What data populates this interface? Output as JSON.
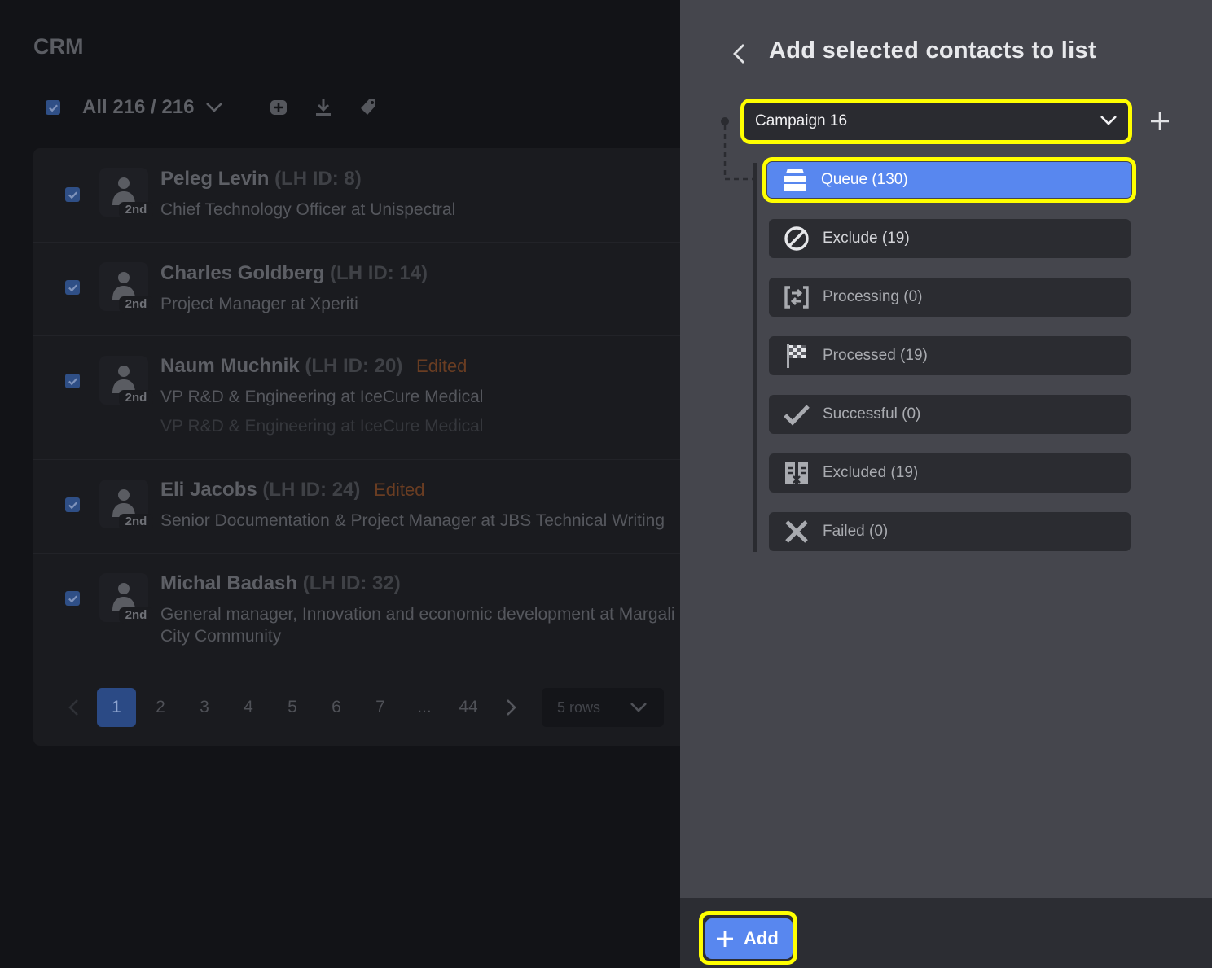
{
  "crm": {
    "title": "CRM",
    "selection_count": "All 216 / 216",
    "contacts": [
      {
        "name": "Peleg Levin",
        "lhid": "(LH ID: 8)",
        "edited": "",
        "degree": "2nd",
        "job": "Chief Technology Officer at Unispectral",
        "job2": ""
      },
      {
        "name": "Charles Goldberg",
        "lhid": "(LH ID: 14)",
        "edited": "",
        "degree": "2nd",
        "job": "Project Manager at Xperiti",
        "job2": ""
      },
      {
        "name": "Naum Muchnik",
        "lhid": "(LH ID: 20)",
        "edited": "Edited",
        "degree": "2nd",
        "job": "VP R&D & Engineering at IceCure Medical",
        "job2": "VP R&D & Engineering at IceCure Medical"
      },
      {
        "name": "Eli Jacobs",
        "lhid": "(LH ID: 24)",
        "edited": "Edited",
        "degree": "2nd",
        "job": "Senior Documentation & Project Manager at JBS Technical Writing",
        "job2": ""
      },
      {
        "name": "Michal Badash",
        "lhid": "(LH ID: 32)",
        "edited": "",
        "degree": "2nd",
        "job": "General manager, Innovation and economic development at Margali",
        "job2": "City Community"
      }
    ],
    "pagination": {
      "pages": [
        "1",
        "2",
        "3",
        "4",
        "5",
        "6",
        "7",
        "...",
        "44"
      ],
      "current": "1",
      "rows": "5 rows"
    }
  },
  "panel": {
    "title": "Add selected contacts to list",
    "campaign": "Campaign 16",
    "statuses": [
      {
        "label": "Queue (130)",
        "icon": "queue-icon",
        "active": true
      },
      {
        "label": "Exclude (19)",
        "icon": "exclude-icon"
      },
      {
        "label": "Processing (0)",
        "icon": "processing-icon"
      },
      {
        "label": "Processed (19)",
        "icon": "checkered-flag-icon"
      },
      {
        "label": "Successful (0)",
        "icon": "check-icon"
      },
      {
        "label": "Excluded (19)",
        "icon": "excluded-icon"
      },
      {
        "label": "Failed (0)",
        "icon": "x-icon"
      }
    ],
    "add_button": "Add"
  },
  "colors": {
    "accent": "#5887ef",
    "highlight": "#ffff00",
    "panel_bg": "#45464d",
    "edited": "#6a3d22"
  }
}
